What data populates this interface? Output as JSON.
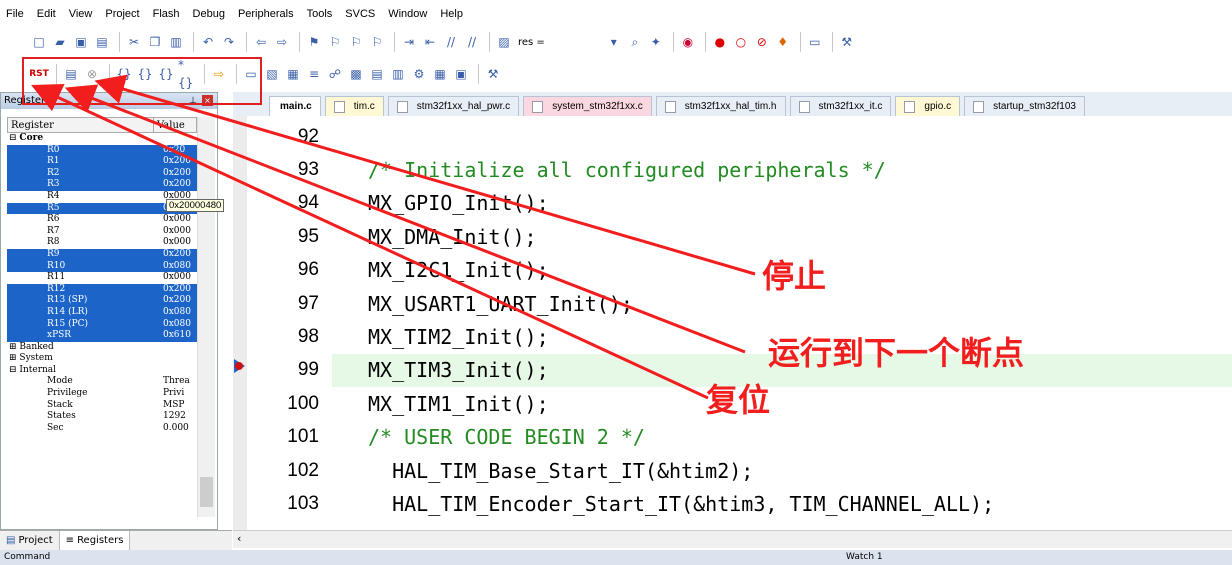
{
  "menu": [
    "File",
    "Edit",
    "View",
    "Project",
    "Flash",
    "Debug",
    "Peripherals",
    "Tools",
    "SVCS",
    "Window",
    "Help"
  ],
  "toolbar1": {
    "res_label": "res ="
  },
  "toolbar2_icons": [
    "reset-icon",
    "run-icon",
    "stop-icon",
    "step-into-icon",
    "step-over-icon",
    "step-out-icon",
    "run-to-cursor-icon",
    "show-next-statement-icon"
  ],
  "registers_panel": {
    "title": "Registers",
    "col_register": "Register",
    "col_value": "Value",
    "rows": [
      {
        "name": "Core",
        "value": "",
        "sel": false,
        "group": true
      },
      {
        "name": "R0",
        "value": "0x20",
        "sel": true
      },
      {
        "name": "R1",
        "value": "0x200",
        "sel": true
      },
      {
        "name": "R2",
        "value": "0x200",
        "sel": true
      },
      {
        "name": "R3",
        "value": "0x200",
        "sel": true
      },
      {
        "name": "R4",
        "value": "0x000",
        "sel": false
      },
      {
        "name": "R5",
        "value": "0x200",
        "sel": true
      },
      {
        "name": "R6",
        "value": "0x000",
        "sel": false
      },
      {
        "name": "R7",
        "value": "0x000",
        "sel": false
      },
      {
        "name": "R8",
        "value": "0x000",
        "sel": false
      },
      {
        "name": "R9",
        "value": "0x200",
        "sel": true
      },
      {
        "name": "R10",
        "value": "0x080",
        "sel": true
      },
      {
        "name": "R11",
        "value": "0x000",
        "sel": false
      },
      {
        "name": "R12",
        "value": "0x200",
        "sel": true
      },
      {
        "name": "R13 (SP)",
        "value": "0x200",
        "sel": true
      },
      {
        "name": "R14 (LR)",
        "value": "0x080",
        "sel": true
      },
      {
        "name": "R15 (PC)",
        "value": "0x080",
        "sel": true
      },
      {
        "name": "xPSR",
        "value": "0x610",
        "sel": true
      },
      {
        "name": "Banked",
        "value": "",
        "sel": false,
        "group": true
      },
      {
        "name": "System",
        "value": "",
        "sel": false,
        "group": true
      },
      {
        "name": "Internal",
        "value": "",
        "sel": false,
        "group": true
      },
      {
        "name": "Mode",
        "value": "Threa",
        "sel": false
      },
      {
        "name": "Privilege",
        "value": "Privi",
        "sel": false
      },
      {
        "name": "Stack",
        "value": "MSP",
        "sel": false
      },
      {
        "name": "States",
        "value": "1292",
        "sel": false
      },
      {
        "name": "Sec",
        "value": "0.000",
        "sel": false
      }
    ],
    "tooltip": "0x20000480"
  },
  "panel_tabs": {
    "project": "Project",
    "registers": "Registers"
  },
  "editor_tabs": [
    "main.c",
    "tim.c",
    "stm32f1xx_hal_pwr.c",
    "system_stm32f1xx.c",
    "stm32f1xx_hal_tim.h",
    "stm32f1xx_it.c",
    "gpio.c",
    "startup_stm32f103"
  ],
  "code_lines": [
    {
      "num": "92",
      "text": "",
      "cls": ""
    },
    {
      "num": "93",
      "text": "/* Initialize all configured peripherals */",
      "cls": "cm"
    },
    {
      "num": "94",
      "text": "MX_GPIO_Init();",
      "cls": ""
    },
    {
      "num": "95",
      "text": "MX_DMA_Init();",
      "cls": ""
    },
    {
      "num": "96",
      "text": "MX_I2C1_Init();",
      "cls": ""
    },
    {
      "num": "97",
      "text": "MX_USART1_UART_Init();",
      "cls": ""
    },
    {
      "num": "98",
      "text": "MX_TIM2_Init();",
      "cls": ""
    },
    {
      "num": "99",
      "text": "MX_TIM3_Init();",
      "cls": "hl"
    },
    {
      "num": "100",
      "text": "MX_TIM1_Init();",
      "cls": ""
    },
    {
      "num": "101",
      "text": "/* USER CODE BEGIN 2 */",
      "cls": "cm"
    },
    {
      "num": "102",
      "text": "  HAL_TIM_Base_Start_IT(&htim2);",
      "cls": ""
    },
    {
      "num": "103",
      "text": "  HAL_TIM_Encoder_Start_IT(&htim3, TIM_CHANNEL_ALL);",
      "cls": ""
    }
  ],
  "annotations": {
    "stop": "停止",
    "run_to_next_breakpoint": "运行到下一个断点",
    "reset": "复位"
  },
  "status": {
    "command": "Command",
    "watch": "Watch 1"
  },
  "colors": {
    "annotation": "#f21d1d",
    "selection": "#1c64c8",
    "comment": "#228b22"
  }
}
